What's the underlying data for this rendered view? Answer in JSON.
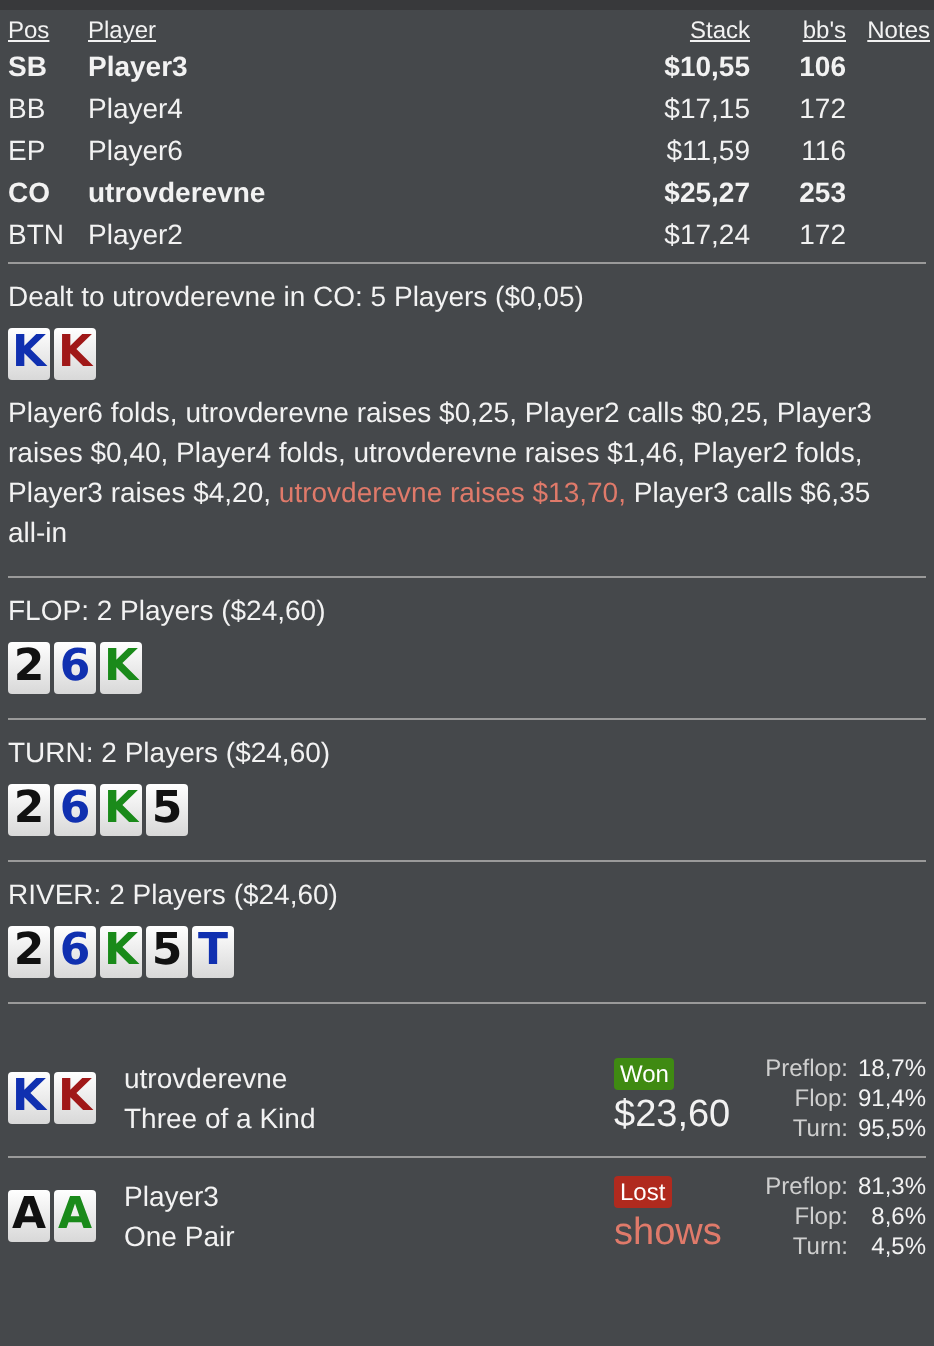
{
  "players_table": {
    "columns": [
      "Pos",
      "Player",
      "Stack",
      "bb's",
      "Notes"
    ],
    "rows": [
      {
        "pos": "SB",
        "player": "Player3",
        "stack": "$10,55",
        "bbs": "106",
        "involved": true
      },
      {
        "pos": "BB",
        "player": "Player4",
        "stack": "$17,15",
        "bbs": "172",
        "involved": false
      },
      {
        "pos": "EP",
        "player": "Player6",
        "stack": "$11,59",
        "bbs": "116",
        "involved": false
      },
      {
        "pos": "CO",
        "player": "utrovderevne",
        "stack": "$25,27",
        "bbs": "253",
        "involved": true
      },
      {
        "pos": "BTN",
        "player": "Player2",
        "stack": "$17,24",
        "bbs": "172",
        "involved": false
      }
    ]
  },
  "preflop": {
    "title": "Dealt to utrovderevne in CO: 5 Players ($0,05)",
    "cards": [
      {
        "rank": "K",
        "color": "#1030b0"
      },
      {
        "rank": "K",
        "color": "#a01818"
      }
    ],
    "actions": [
      {
        "text": "Player6 folds, utrovderevne raises $0,25, Player2 calls $0,25, Player3 raises $0,40, Player4 folds, utrovderevne raises $1,46, Player2 folds, Player3 raises $4,20, ",
        "highlight": false
      },
      {
        "text": "utrovderevne raises $13,70,",
        "highlight": true
      },
      {
        "text": " Player3 calls $6,35 all-in",
        "highlight": false
      }
    ]
  },
  "streets": [
    {
      "title": "FLOP: 2 Players ($24,60)",
      "cards": [
        {
          "rank": "2",
          "color": "#111111"
        },
        {
          "rank": "6",
          "color": "#1030b0"
        },
        {
          "rank": "K",
          "color": "#1a8a1a"
        }
      ]
    },
    {
      "title": "TURN: 2 Players ($24,60)",
      "cards": [
        {
          "rank": "2",
          "color": "#111111"
        },
        {
          "rank": "6",
          "color": "#1030b0"
        },
        {
          "rank": "K",
          "color": "#1a8a1a"
        },
        {
          "rank": "5",
          "color": "#111111"
        }
      ]
    },
    {
      "title": "RIVER: 2 Players ($24,60)",
      "cards": [
        {
          "rank": "2",
          "color": "#111111"
        },
        {
          "rank": "6",
          "color": "#1030b0"
        },
        {
          "rank": "K",
          "color": "#1a8a1a"
        },
        {
          "rank": "5",
          "color": "#111111"
        },
        {
          "rank": "T",
          "color": "#1030b0"
        }
      ]
    }
  ],
  "results": [
    {
      "cards": [
        {
          "rank": "K",
          "color": "#1030b0"
        },
        {
          "rank": "K",
          "color": "#a01818"
        }
      ],
      "player": "utrovderevne",
      "hand": "Three of a Kind",
      "won": true,
      "badge": "Won",
      "amount": "$23,60",
      "equity": [
        {
          "label": "Preflop:",
          "value": "18,7%"
        },
        {
          "label": "Flop:",
          "value": "91,4%"
        },
        {
          "label": "Turn:",
          "value": "95,5%"
        }
      ]
    },
    {
      "cards": [
        {
          "rank": "A",
          "color": "#111111"
        },
        {
          "rank": "A",
          "color": "#1a8a1a"
        }
      ],
      "player": "Player3",
      "hand": "One Pair",
      "won": false,
      "badge": "Lost",
      "amount": "shows",
      "equity": [
        {
          "label": "Preflop:",
          "value": "81,3%"
        },
        {
          "label": "Flop:",
          "value": "8,6%"
        },
        {
          "label": "Turn:",
          "value": "4,5%"
        }
      ]
    }
  ]
}
